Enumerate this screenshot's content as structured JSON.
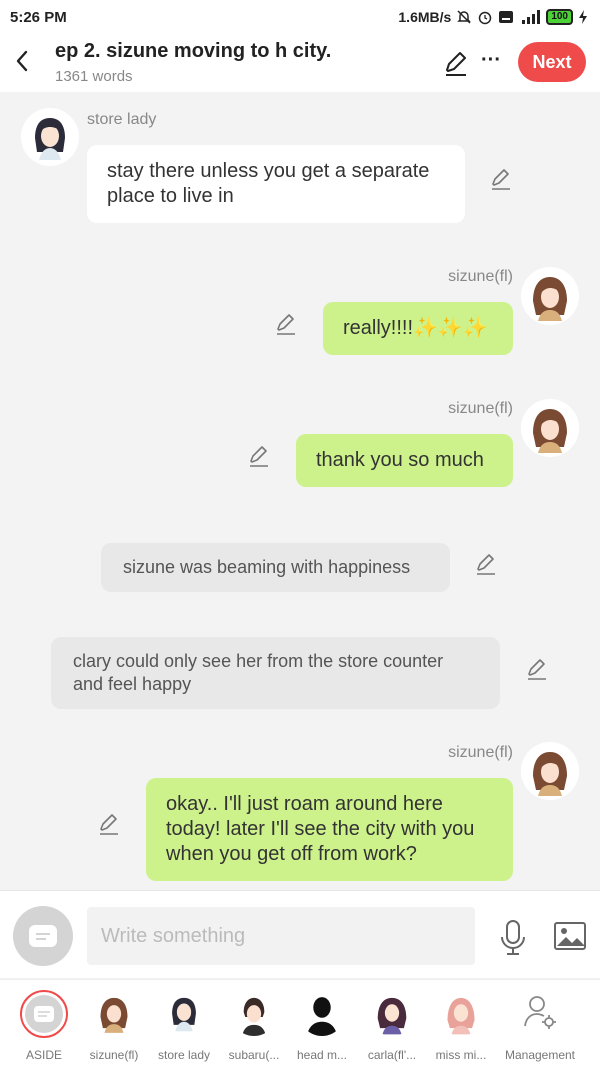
{
  "status": {
    "time": "5:26 PM",
    "speed": "1.6MB/s",
    "battery": "100"
  },
  "header": {
    "title": "ep 2. sizune moving to h city.",
    "subtitle": "1361 words",
    "next_label": "Next",
    "more_label": "···"
  },
  "messages": [
    {
      "speaker": "store lady",
      "text": "stay there unless you get a separate place to live in"
    },
    {
      "speaker": "sizune(fl)",
      "text": "really!!!!✨✨✨"
    },
    {
      "speaker": "sizune(fl)",
      "text": "thank you so much"
    },
    {
      "speaker": "",
      "text": "sizune was beaming with happiness"
    },
    {
      "speaker": "",
      "text": "clary could only see her from the store counter and feel happy"
    },
    {
      "speaker": "sizune(fl)",
      "text": "okay.. I'll just roam around here today! later I'll see the city with you when you get off from work?"
    }
  ],
  "input": {
    "placeholder": "Write something"
  },
  "characters": [
    {
      "label": "ASIDE"
    },
    {
      "label": "sizune(fl)"
    },
    {
      "label": "store lady"
    },
    {
      "label": "subaru(..."
    },
    {
      "label": "head m..."
    },
    {
      "label": "carla(fl'..."
    },
    {
      "label": "miss mi..."
    },
    {
      "label": "Management"
    }
  ],
  "colors": {
    "accent": "#ef4b4b",
    "green_bubble": "#cdf28b",
    "narration_bubble": "#e8e8e8"
  }
}
